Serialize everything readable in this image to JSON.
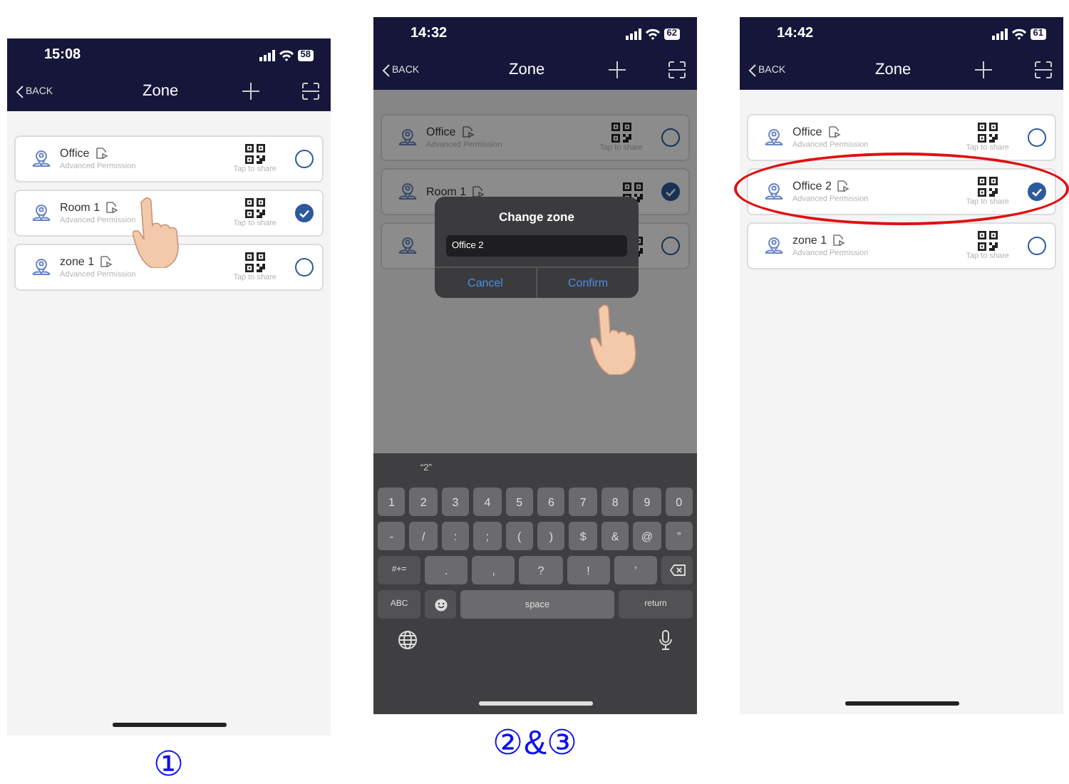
{
  "phones": [
    {
      "status": {
        "time": "15:08",
        "battery": "58"
      },
      "nav": {
        "back": "BACK",
        "title": "Zone"
      },
      "dimmed": false,
      "zones": [
        {
          "name": "Office",
          "permission": "Advanced Permission",
          "share": "Tap to share",
          "selected": false,
          "tapped": false,
          "highlighted": false
        },
        {
          "name": "Room 1",
          "permission": "Advanced Permission",
          "share": "Tap to share",
          "selected": true,
          "tapped": true,
          "highlighted": false
        },
        {
          "name": "zone 1",
          "permission": "Advanced Permission",
          "share": "Tap to share",
          "selected": false,
          "tapped": false,
          "highlighted": false
        }
      ],
      "caption": "①"
    },
    {
      "status": {
        "time": "14:32",
        "battery": "62"
      },
      "nav": {
        "back": "BACK",
        "title": "Zone"
      },
      "dimmed": true,
      "zones": [
        {
          "name": "Office",
          "permission": "Advanced Permission",
          "share": "Tap to share",
          "selected": false,
          "tapped": false,
          "highlighted": false
        },
        {
          "name": "Room 1",
          "selected": true,
          "tapped": false,
          "highlighted": false
        },
        {
          "selected": false,
          "tapped": false,
          "highlighted": false
        }
      ],
      "dialog": {
        "title": "Change zone",
        "value": "Office 2",
        "cancel": "Cancel",
        "confirm": "Confirm",
        "confirm_tapped": true
      },
      "keyboard": {
        "suggestion": "“2”",
        "number_row": [
          {
            "label": "1",
            "kind": "char"
          },
          {
            "label": "2",
            "kind": "char"
          },
          {
            "label": "3",
            "kind": "char"
          },
          {
            "label": "4",
            "kind": "char"
          },
          {
            "label": "5",
            "kind": "char"
          },
          {
            "label": "6",
            "kind": "char"
          },
          {
            "label": "7",
            "kind": "char"
          },
          {
            "label": "8",
            "kind": "char"
          },
          {
            "label": "9",
            "kind": "char"
          },
          {
            "label": "0",
            "kind": "char"
          }
        ],
        "symbol_row": [
          {
            "label": "-",
            "kind": "char"
          },
          {
            "label": "/",
            "kind": "char"
          },
          {
            "label": ":",
            "kind": "char"
          },
          {
            "label": ";",
            "kind": "char"
          },
          {
            "label": "(",
            "kind": "char"
          },
          {
            "label": ")",
            "kind": "char"
          },
          {
            "label": "$",
            "kind": "char"
          },
          {
            "label": "&",
            "kind": "char"
          },
          {
            "label": "@",
            "kind": "char"
          },
          {
            "label": "”",
            "kind": "char"
          }
        ],
        "punctuation_row": [
          {
            "label": "#+=",
            "kind": "func"
          },
          {
            "label": ".",
            "kind": "char"
          },
          {
            "label": ",",
            "kind": "char"
          },
          {
            "label": "?",
            "kind": "char"
          },
          {
            "label": "!",
            "kind": "char"
          },
          {
            "label": "’",
            "kind": "char"
          },
          {
            "kind": "delete"
          }
        ],
        "bottom_row": [
          {
            "label": "ABC",
            "kind": "func"
          },
          {
            "kind": "emoji"
          },
          {
            "label": "space",
            "kind": "space"
          },
          {
            "label": "return",
            "kind": "func"
          }
        ]
      },
      "caption": "②&③"
    },
    {
      "status": {
        "time": "14:42",
        "battery": "61"
      },
      "nav": {
        "back": "BACK",
        "title": "Zone"
      },
      "dimmed": false,
      "zones": [
        {
          "name": "Office",
          "permission": "Advanced Permission",
          "share": "Tap to share",
          "selected": false,
          "tapped": false,
          "highlighted": false
        },
        {
          "name": "Office 2",
          "permission": "Advanced Permission",
          "share": "Tap to share",
          "selected": true,
          "tapped": false,
          "highlighted": true
        },
        {
          "name": "zone 1",
          "permission": "Advanced Permission",
          "share": "Tap to share",
          "selected": false,
          "tapped": false,
          "highlighted": false
        }
      ]
    }
  ]
}
